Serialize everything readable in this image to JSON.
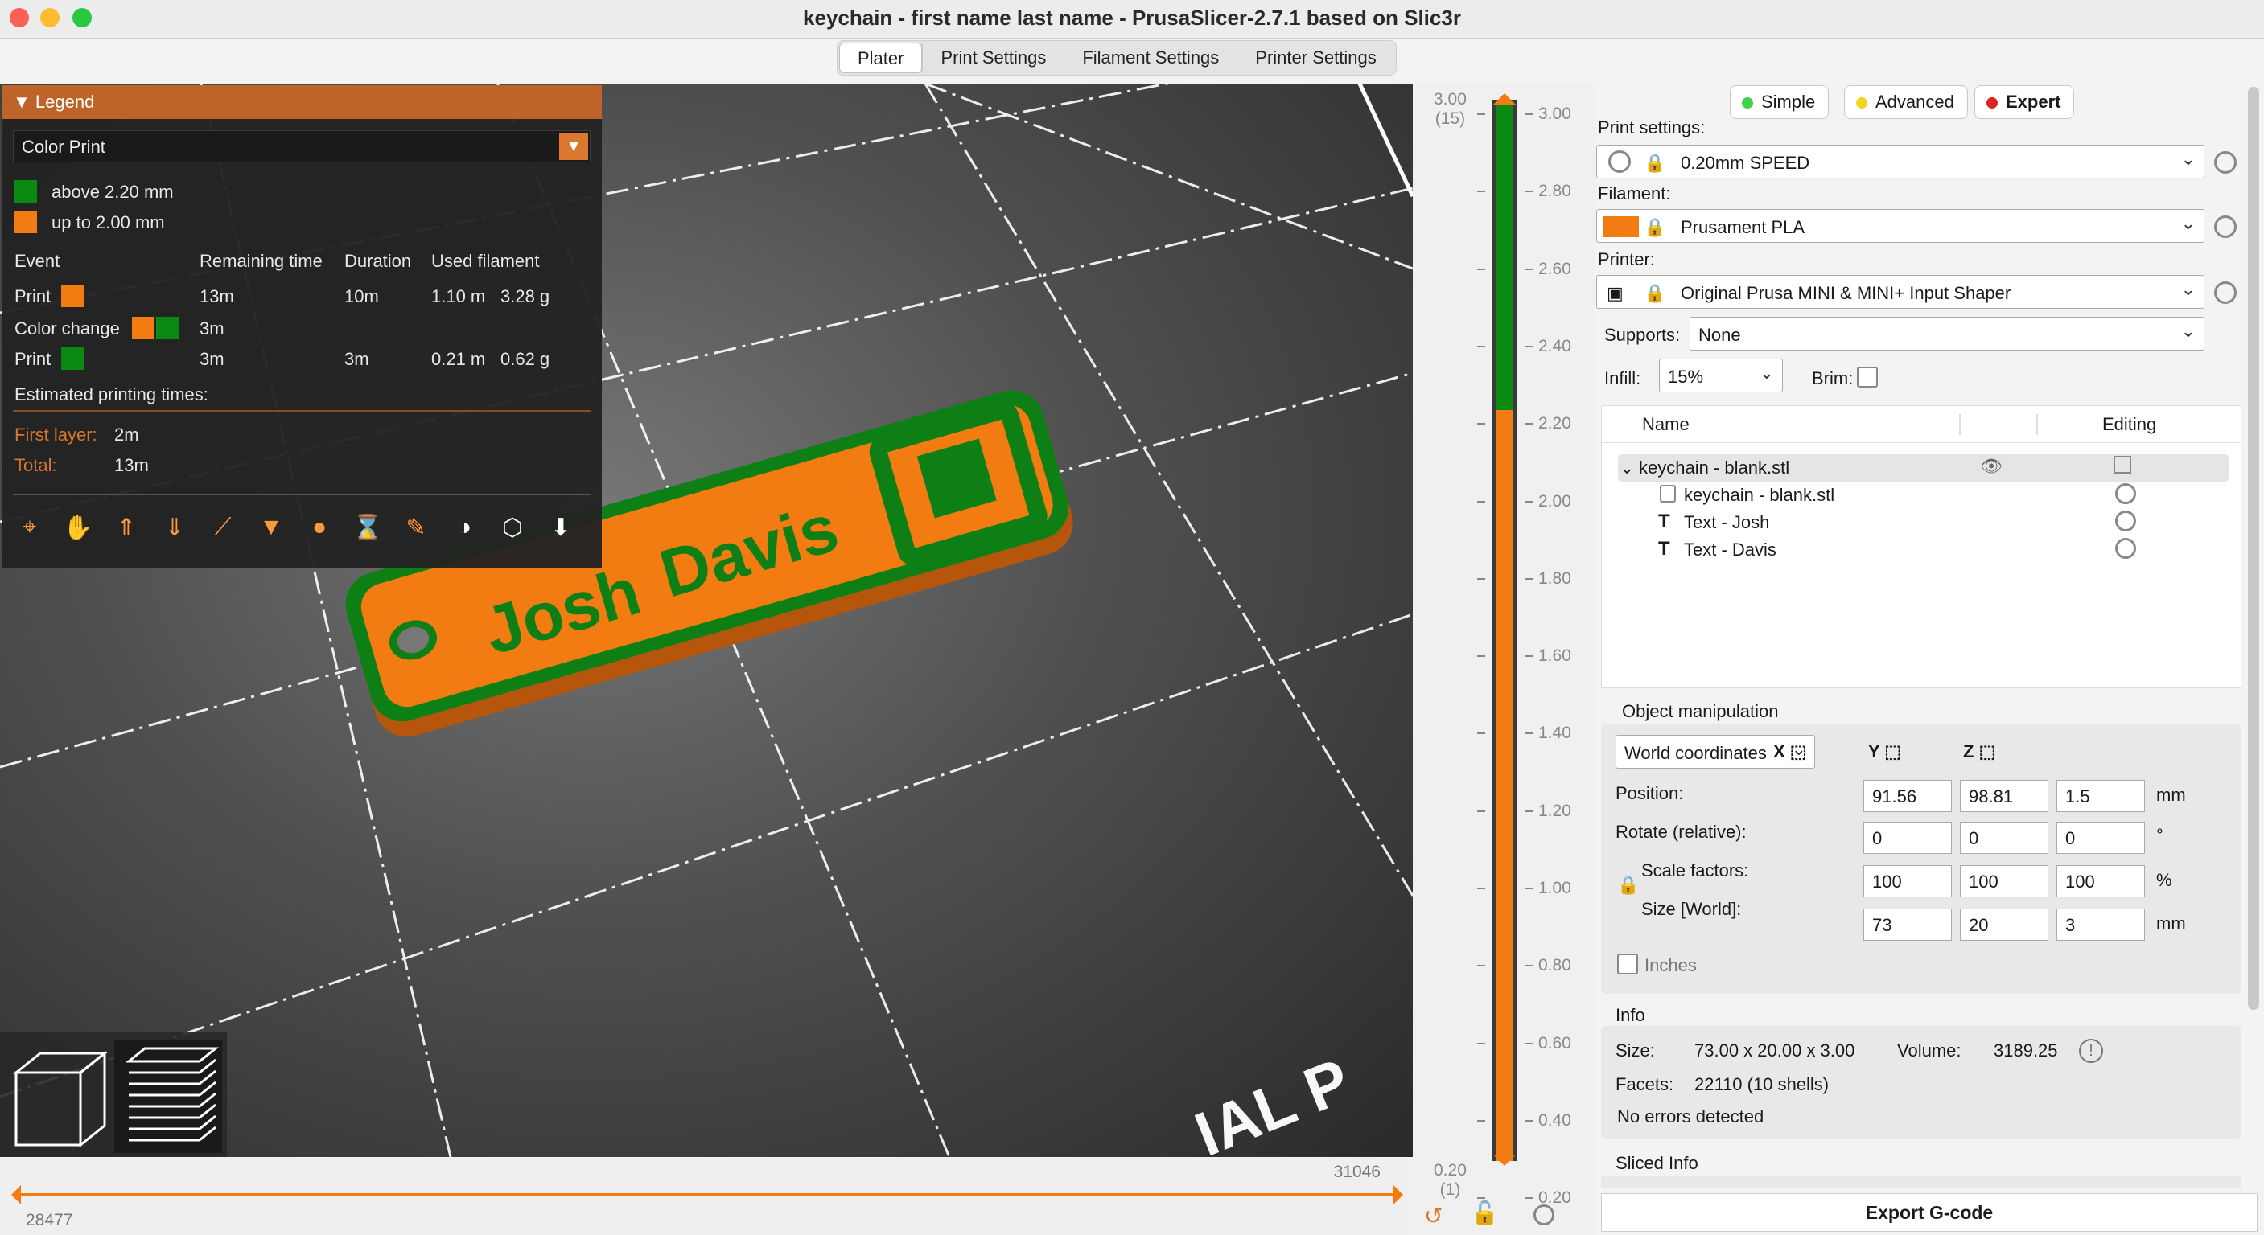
{
  "window": {
    "title": "keychain - first name last name - PrusaSlicer-2.7.1 based on Slic3r"
  },
  "tabs": [
    "Plater",
    "Print Settings",
    "Filament Settings",
    "Printer Settings"
  ],
  "legend": {
    "header": "Legend",
    "view_type": "Color Print",
    "ranges": [
      {
        "label": "above 2.20 mm",
        "color": "#0a8a12"
      },
      {
        "label": "up to 2.00 mm",
        "color": "#f27b12"
      }
    ],
    "columns": [
      "Event",
      "Remaining time",
      "Duration",
      "Used filament"
    ],
    "events": [
      {
        "event": "Print",
        "remaining": "13m",
        "duration": "10m",
        "length": "1.10 m",
        "weight": "3.28 g"
      },
      {
        "event": "Color change",
        "remaining": "3m",
        "duration": "",
        "length": "",
        "weight": ""
      },
      {
        "event": "Print",
        "remaining": "3m",
        "duration": "3m",
        "length": "0.21 m",
        "weight": "0.62 g"
      }
    ],
    "est_title": "Estimated printing times:",
    "first_layer_label": "First layer:",
    "first_layer_value": "2m",
    "total_label": "Total:",
    "total_value": "13m"
  },
  "scene": {
    "text_josh": "Josh",
    "text_davis": "Davis",
    "bed_text": "IAL P"
  },
  "hslider": {
    "max": "31046",
    "min": "28477"
  },
  "vslider": {
    "top_value": "3.00",
    "top_layer": "(15)",
    "bottom_value": "0.20",
    "bottom_layer": "(1)",
    "ticks": [
      "3.00",
      "2.80",
      "2.60",
      "2.40",
      "2.20",
      "2.00",
      "1.80",
      "1.60",
      "1.40",
      "1.20",
      "1.00",
      "0.80",
      "0.60",
      "0.40",
      "0.20"
    ],
    "color_top": "#0a8a12",
    "color_bottom": "#f27b12"
  },
  "mode": {
    "simple": "Simple",
    "advanced": "Advanced",
    "expert": "Expert"
  },
  "print_settings": {
    "label": "Print settings:",
    "value": "0.20mm SPEED"
  },
  "filament": {
    "label": "Filament:",
    "value": "Prusament PLA",
    "color": "#f27b12"
  },
  "printer": {
    "label": "Printer:",
    "value": "Original Prusa MINI & MINI+ Input Shaper"
  },
  "supports": {
    "label": "Supports:",
    "value": "None"
  },
  "infill": {
    "label": "Infill:",
    "value": "15%"
  },
  "brim": {
    "label": "Brim:"
  },
  "object_list": {
    "col_name": "Name",
    "col_editing": "Editing",
    "items": [
      "keychain - blank.stl",
      "keychain - blank.stl",
      "Text - Josh",
      "Text - Davis"
    ]
  },
  "object_manipulation": {
    "title": "Object manipulation",
    "coords": "World coordinates",
    "axes": [
      "X",
      "Y",
      "Z"
    ],
    "position_label": "Position:",
    "position": [
      "91.56",
      "98.81",
      "1.5"
    ],
    "position_unit": "mm",
    "rotate_label": "Rotate (relative):",
    "rotate": [
      "0",
      "0",
      "0"
    ],
    "rotate_unit": "°",
    "scale_label": "Scale factors:",
    "scale": [
      "100",
      "100",
      "100"
    ],
    "scale_unit": "%",
    "size_label": "Size [World]:",
    "size": [
      "73",
      "20",
      "3"
    ],
    "size_unit": "mm",
    "inches_label": "Inches"
  },
  "info": {
    "title": "Info",
    "size_label": "Size:",
    "size_value": "73.00 x 20.00 x 3.00",
    "volume_label": "Volume:",
    "volume_value": "3189.25",
    "facets_label": "Facets:",
    "facets_value": "22110 (10 shells)",
    "status": "No errors detected"
  },
  "sliced_info": {
    "title": "Sliced Info"
  },
  "export": {
    "label": "Export G-code"
  }
}
